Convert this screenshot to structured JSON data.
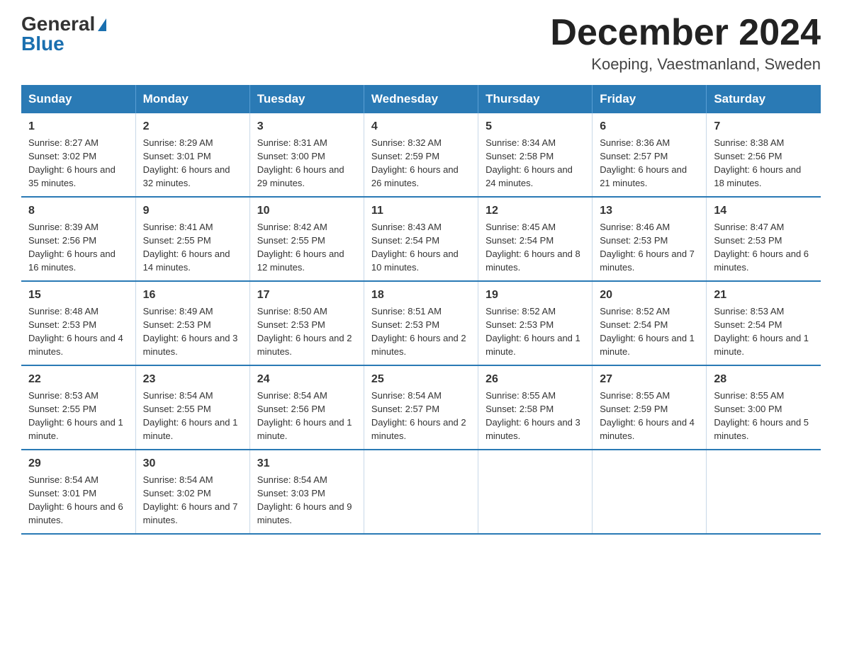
{
  "header": {
    "logo_general": "General",
    "logo_blue": "Blue",
    "month_title": "December 2024",
    "location": "Koeping, Vaestmanland, Sweden"
  },
  "days_of_week": [
    "Sunday",
    "Monday",
    "Tuesday",
    "Wednesday",
    "Thursday",
    "Friday",
    "Saturday"
  ],
  "weeks": [
    [
      {
        "day": "1",
        "sunrise": "8:27 AM",
        "sunset": "3:02 PM",
        "daylight": "6 hours and 35 minutes."
      },
      {
        "day": "2",
        "sunrise": "8:29 AM",
        "sunset": "3:01 PM",
        "daylight": "6 hours and 32 minutes."
      },
      {
        "day": "3",
        "sunrise": "8:31 AM",
        "sunset": "3:00 PM",
        "daylight": "6 hours and 29 minutes."
      },
      {
        "day": "4",
        "sunrise": "8:32 AM",
        "sunset": "2:59 PM",
        "daylight": "6 hours and 26 minutes."
      },
      {
        "day": "5",
        "sunrise": "8:34 AM",
        "sunset": "2:58 PM",
        "daylight": "6 hours and 24 minutes."
      },
      {
        "day": "6",
        "sunrise": "8:36 AM",
        "sunset": "2:57 PM",
        "daylight": "6 hours and 21 minutes."
      },
      {
        "day": "7",
        "sunrise": "8:38 AM",
        "sunset": "2:56 PM",
        "daylight": "6 hours and 18 minutes."
      }
    ],
    [
      {
        "day": "8",
        "sunrise": "8:39 AM",
        "sunset": "2:56 PM",
        "daylight": "6 hours and 16 minutes."
      },
      {
        "day": "9",
        "sunrise": "8:41 AM",
        "sunset": "2:55 PM",
        "daylight": "6 hours and 14 minutes."
      },
      {
        "day": "10",
        "sunrise": "8:42 AM",
        "sunset": "2:55 PM",
        "daylight": "6 hours and 12 minutes."
      },
      {
        "day": "11",
        "sunrise": "8:43 AM",
        "sunset": "2:54 PM",
        "daylight": "6 hours and 10 minutes."
      },
      {
        "day": "12",
        "sunrise": "8:45 AM",
        "sunset": "2:54 PM",
        "daylight": "6 hours and 8 minutes."
      },
      {
        "day": "13",
        "sunrise": "8:46 AM",
        "sunset": "2:53 PM",
        "daylight": "6 hours and 7 minutes."
      },
      {
        "day": "14",
        "sunrise": "8:47 AM",
        "sunset": "2:53 PM",
        "daylight": "6 hours and 6 minutes."
      }
    ],
    [
      {
        "day": "15",
        "sunrise": "8:48 AM",
        "sunset": "2:53 PM",
        "daylight": "6 hours and 4 minutes."
      },
      {
        "day": "16",
        "sunrise": "8:49 AM",
        "sunset": "2:53 PM",
        "daylight": "6 hours and 3 minutes."
      },
      {
        "day": "17",
        "sunrise": "8:50 AM",
        "sunset": "2:53 PM",
        "daylight": "6 hours and 2 minutes."
      },
      {
        "day": "18",
        "sunrise": "8:51 AM",
        "sunset": "2:53 PM",
        "daylight": "6 hours and 2 minutes."
      },
      {
        "day": "19",
        "sunrise": "8:52 AM",
        "sunset": "2:53 PM",
        "daylight": "6 hours and 1 minute."
      },
      {
        "day": "20",
        "sunrise": "8:52 AM",
        "sunset": "2:54 PM",
        "daylight": "6 hours and 1 minute."
      },
      {
        "day": "21",
        "sunrise": "8:53 AM",
        "sunset": "2:54 PM",
        "daylight": "6 hours and 1 minute."
      }
    ],
    [
      {
        "day": "22",
        "sunrise": "8:53 AM",
        "sunset": "2:55 PM",
        "daylight": "6 hours and 1 minute."
      },
      {
        "day": "23",
        "sunrise": "8:54 AM",
        "sunset": "2:55 PM",
        "daylight": "6 hours and 1 minute."
      },
      {
        "day": "24",
        "sunrise": "8:54 AM",
        "sunset": "2:56 PM",
        "daylight": "6 hours and 1 minute."
      },
      {
        "day": "25",
        "sunrise": "8:54 AM",
        "sunset": "2:57 PM",
        "daylight": "6 hours and 2 minutes."
      },
      {
        "day": "26",
        "sunrise": "8:55 AM",
        "sunset": "2:58 PM",
        "daylight": "6 hours and 3 minutes."
      },
      {
        "day": "27",
        "sunrise": "8:55 AM",
        "sunset": "2:59 PM",
        "daylight": "6 hours and 4 minutes."
      },
      {
        "day": "28",
        "sunrise": "8:55 AM",
        "sunset": "3:00 PM",
        "daylight": "6 hours and 5 minutes."
      }
    ],
    [
      {
        "day": "29",
        "sunrise": "8:54 AM",
        "sunset": "3:01 PM",
        "daylight": "6 hours and 6 minutes."
      },
      {
        "day": "30",
        "sunrise": "8:54 AM",
        "sunset": "3:02 PM",
        "daylight": "6 hours and 7 minutes."
      },
      {
        "day": "31",
        "sunrise": "8:54 AM",
        "sunset": "3:03 PM",
        "daylight": "6 hours and 9 minutes."
      },
      null,
      null,
      null,
      null
    ]
  ]
}
